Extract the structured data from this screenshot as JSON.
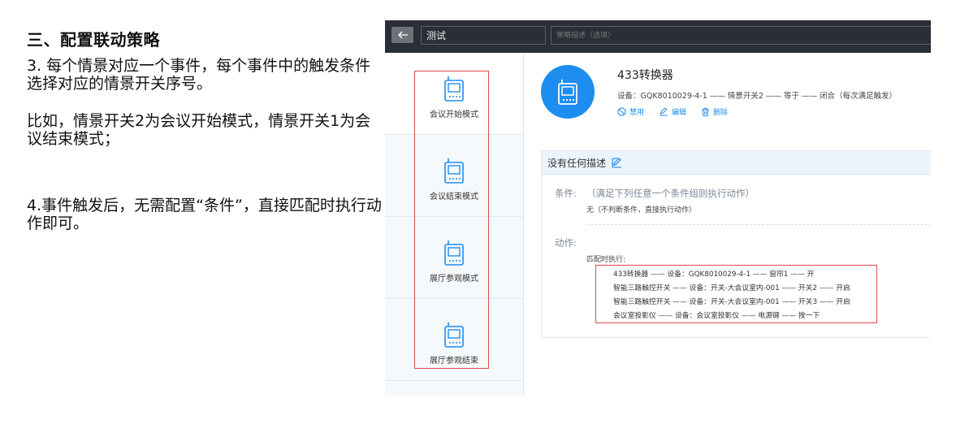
{
  "doc": {
    "heading": "三、配置联动策略",
    "p1": "3. 每个情景对应一个事件，每个事件中的触发条件选择对应的情景开关序号。",
    "p2": "比如，情景开关2为会议开始模式，情景开关1为会议结束模式；",
    "p3": "4.事件触发后，无需配置“条件”，直接匹配时执行动作即可。"
  },
  "topbar": {
    "name_value": "测试",
    "desc_placeholder": "策略描述（选填）"
  },
  "scenes": [
    {
      "label": "会议开始模式",
      "icon": "device-icon"
    },
    {
      "label": "会议结束模式",
      "icon": "device-icon"
    },
    {
      "label": "展厅参观模式",
      "icon": "device-icon"
    },
    {
      "label": "展厅参观结束",
      "icon": "device-icon"
    }
  ],
  "event": {
    "device_name": "433转换器",
    "trigger_line": "设备：GQK8010029-4-1 —— 情景开关2 —— 等于 —— 闭合（每次满足触发）",
    "disable_label": "禁用",
    "edit_label": "编辑",
    "delete_label": "删除"
  },
  "panel": {
    "description": "没有任何描述",
    "condition_label": "条件:",
    "condition_text": "（满足下列任意一个条件组则执行动作）",
    "condition_sub": "无（不判断条件，直接执行动作）",
    "action_label": "动作:",
    "match_label": "匹配时执行:",
    "actions": [
      "433转换器 —— 设备：GQK8010029-4-1 —— 窗帘1 —— 开",
      "智能三路触控开关 —— 设备：开关-大会议室内-001 —— 开关2 —— 开启",
      "智能三路触控开关 —— 设备：开关-大会议室内-001 —— 开关3 —— 开启",
      "会议室投影仪 —— 设备：会议室投影仪 —— 电源键 —— 按一下"
    ]
  },
  "colors": {
    "accent": "#1d8df0",
    "topbar": "#2a2e36",
    "highlight": "#e24a4a"
  }
}
